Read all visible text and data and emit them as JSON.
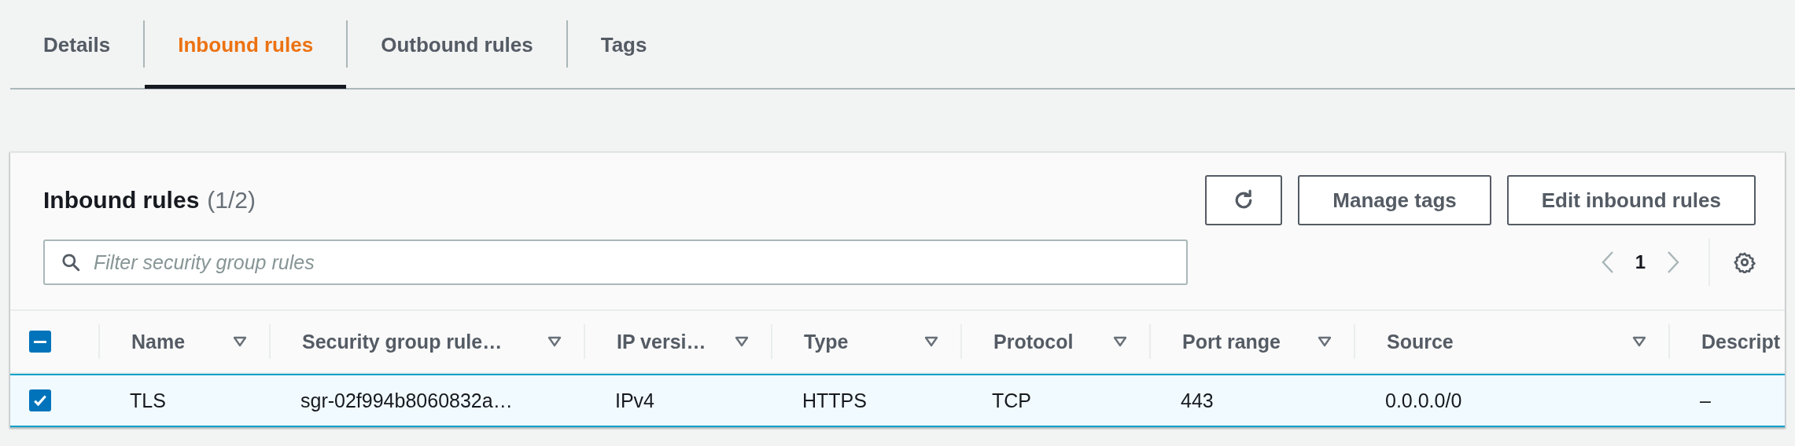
{
  "tabs": [
    {
      "label": "Details",
      "selected": false
    },
    {
      "label": "Inbound rules",
      "selected": true
    },
    {
      "label": "Outbound rules",
      "selected": false
    },
    {
      "label": "Tags",
      "selected": false
    }
  ],
  "panel": {
    "title": "Inbound rules",
    "count": "(1/2)",
    "buttons": [
      {
        "kind": "refresh"
      },
      {
        "kind": "text",
        "label": "Manage tags"
      },
      {
        "kind": "text",
        "label": "Edit inbound rules"
      }
    ],
    "filter": {
      "placeholder": "Filter security group rules"
    },
    "pagination": {
      "page": "1"
    },
    "table": {
      "header_checkbox": {
        "indeterminate": true
      },
      "columns": [
        {
          "label": "Name",
          "sortable": true
        },
        {
          "label": "Security group rule…",
          "sortable": true
        },
        {
          "label": "IP versi…",
          "sortable": true
        },
        {
          "label": "Type",
          "sortable": true
        },
        {
          "label": "Protocol",
          "sortable": true
        },
        {
          "label": "Port range",
          "sortable": true
        },
        {
          "label": "Source",
          "sortable": true
        },
        {
          "label": "Descript",
          "sortable": false
        }
      ],
      "rows": [
        {
          "selected": true,
          "cells": [
            "TLS",
            "sgr-02f994b8060832a…",
            "IPv4",
            "HTTPS",
            "TCP",
            "443",
            "0.0.0.0/0",
            "–"
          ]
        }
      ]
    }
  }
}
